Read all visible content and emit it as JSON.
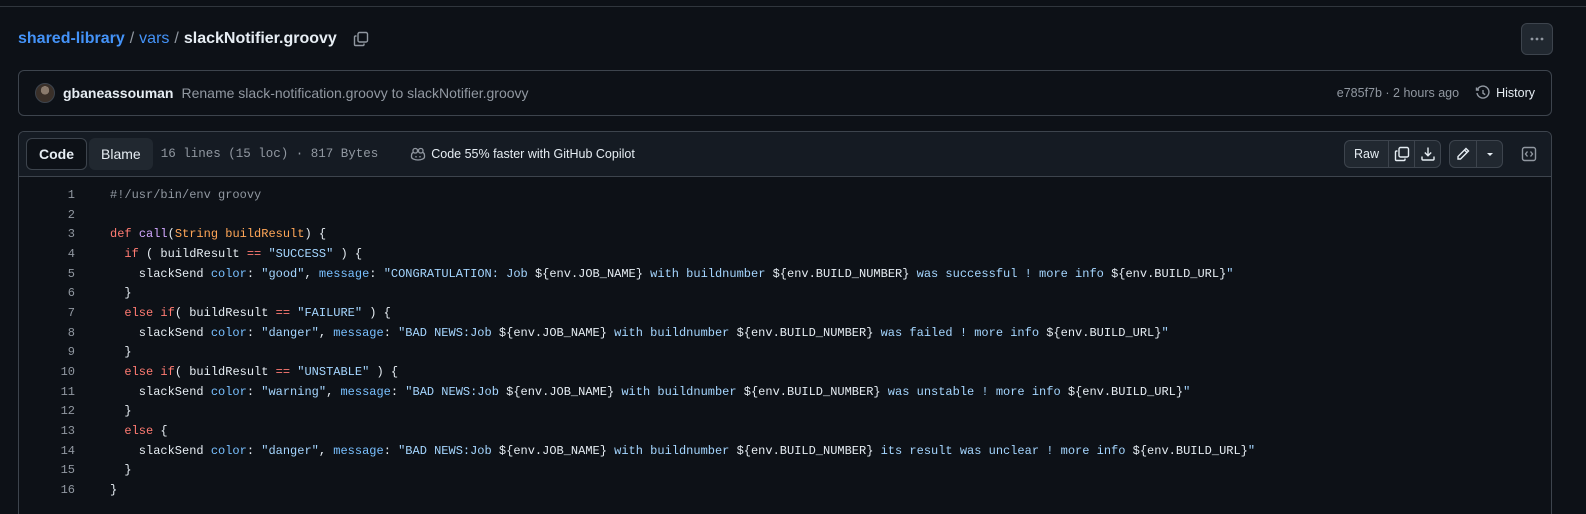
{
  "breadcrumb": {
    "repo": "shared-library",
    "folder": "vars",
    "file": "slackNotifier.groovy",
    "separator": "/"
  },
  "commit": {
    "author": "gbaneassouman",
    "message": "Rename slack-notification.groovy to slackNotifier.groovy",
    "meta": "e785f7b · 2 hours ago",
    "history_label": "History"
  },
  "file_header": {
    "code_tab": "Code",
    "blame_tab": "Blame",
    "stats": "16 lines (15 loc) · 817 Bytes",
    "copilot": "Code 55% faster with GitHub Copilot",
    "raw_label": "Raw"
  },
  "code_lines": [
    {
      "n": "1",
      "segs": [
        [
          "c",
          "#!/usr/bin/env groovy"
        ]
      ]
    },
    {
      "n": "2",
      "segs": []
    },
    {
      "n": "3",
      "segs": [
        [
          "k",
          "def"
        ],
        [
          "",
          " "
        ],
        [
          "f",
          "call"
        ],
        [
          "",
          "("
        ],
        [
          "t",
          "String"
        ],
        [
          "",
          " "
        ],
        [
          "t",
          "buildResult"
        ],
        [
          "",
          ") {"
        ]
      ]
    },
    {
      "n": "4",
      "segs": [
        [
          "",
          "  "
        ],
        [
          "k",
          "if"
        ],
        [
          "",
          " ( buildResult "
        ],
        [
          "k",
          "=="
        ],
        [
          "",
          " "
        ],
        [
          "s",
          "\"SUCCESS\""
        ],
        [
          "",
          " ) {"
        ]
      ]
    },
    {
      "n": "5",
      "segs": [
        [
          "",
          "    slackSend "
        ],
        [
          "p",
          "color"
        ],
        [
          "",
          ": "
        ],
        [
          "s",
          "\"good\""
        ],
        [
          "",
          ", "
        ],
        [
          "p",
          "message"
        ],
        [
          "",
          ": "
        ],
        [
          "s",
          "\"CONGRATULATION: Job "
        ],
        [
          "",
          "${env.JOB_NAME}"
        ],
        [
          "s",
          " with buildnumber "
        ],
        [
          "",
          "${env.BUILD_NUMBER}"
        ],
        [
          "s",
          " was successful ! more info "
        ],
        [
          "",
          "${env.BUILD_URL}"
        ],
        [
          "s",
          "\""
        ]
      ]
    },
    {
      "n": "6",
      "segs": [
        [
          "",
          "  }"
        ]
      ]
    },
    {
      "n": "7",
      "segs": [
        [
          "",
          "  "
        ],
        [
          "k",
          "else if"
        ],
        [
          "",
          "( buildResult "
        ],
        [
          "k",
          "=="
        ],
        [
          "",
          " "
        ],
        [
          "s",
          "\"FAILURE\""
        ],
        [
          "",
          " ) {"
        ]
      ]
    },
    {
      "n": "8",
      "segs": [
        [
          "",
          "    slackSend "
        ],
        [
          "p",
          "color"
        ],
        [
          "",
          ": "
        ],
        [
          "s",
          "\"danger\""
        ],
        [
          "",
          ", "
        ],
        [
          "p",
          "message"
        ],
        [
          "",
          ": "
        ],
        [
          "s",
          "\"BAD NEWS:Job "
        ],
        [
          "",
          "${env.JOB_NAME}"
        ],
        [
          "s",
          " with buildnumber "
        ],
        [
          "",
          "${env.BUILD_NUMBER}"
        ],
        [
          "s",
          " was failed ! more info "
        ],
        [
          "",
          "${env.BUILD_URL}"
        ],
        [
          "s",
          "\""
        ]
      ]
    },
    {
      "n": "9",
      "segs": [
        [
          "",
          "  }"
        ]
      ]
    },
    {
      "n": "10",
      "segs": [
        [
          "",
          "  "
        ],
        [
          "k",
          "else if"
        ],
        [
          "",
          "( buildResult "
        ],
        [
          "k",
          "=="
        ],
        [
          "",
          " "
        ],
        [
          "s",
          "\"UNSTABLE\""
        ],
        [
          "",
          " ) {"
        ]
      ]
    },
    {
      "n": "11",
      "segs": [
        [
          "",
          "    slackSend "
        ],
        [
          "p",
          "color"
        ],
        [
          "",
          ": "
        ],
        [
          "s",
          "\"warning\""
        ],
        [
          "",
          ", "
        ],
        [
          "p",
          "message"
        ],
        [
          "",
          ": "
        ],
        [
          "s",
          "\"BAD NEWS:Job "
        ],
        [
          "",
          "${env.JOB_NAME}"
        ],
        [
          "s",
          " with buildnumber "
        ],
        [
          "",
          "${env.BUILD_NUMBER}"
        ],
        [
          "s",
          " was unstable ! more info "
        ],
        [
          "",
          "${env.BUILD_URL}"
        ],
        [
          "s",
          "\""
        ]
      ]
    },
    {
      "n": "12",
      "segs": [
        [
          "",
          "  }"
        ]
      ]
    },
    {
      "n": "13",
      "segs": [
        [
          "",
          "  "
        ],
        [
          "k",
          "else"
        ],
        [
          "",
          " {"
        ]
      ]
    },
    {
      "n": "14",
      "segs": [
        [
          "",
          "    slackSend "
        ],
        [
          "p",
          "color"
        ],
        [
          "",
          ": "
        ],
        [
          "s",
          "\"danger\""
        ],
        [
          "",
          ", "
        ],
        [
          "p",
          "message"
        ],
        [
          "",
          ": "
        ],
        [
          "s",
          "\"BAD NEWS:Job "
        ],
        [
          "",
          "${env.JOB_NAME}"
        ],
        [
          "s",
          " with buildnumber "
        ],
        [
          "",
          "${env.BUILD_NUMBER}"
        ],
        [
          "s",
          " its result was unclear ! more info "
        ],
        [
          "",
          "${env.BUILD_URL}"
        ],
        [
          "s",
          "\""
        ]
      ]
    },
    {
      "n": "15",
      "segs": [
        [
          "",
          "  }"
        ]
      ]
    },
    {
      "n": "16",
      "segs": [
        [
          "",
          "}"
        ]
      ]
    }
  ],
  "colors": {
    "background": "#0d1117",
    "link": "#4493f8",
    "keyword": "#ff7b72",
    "string": "#a5d6ff",
    "function": "#d2a8ff",
    "type": "#ffa657"
  }
}
